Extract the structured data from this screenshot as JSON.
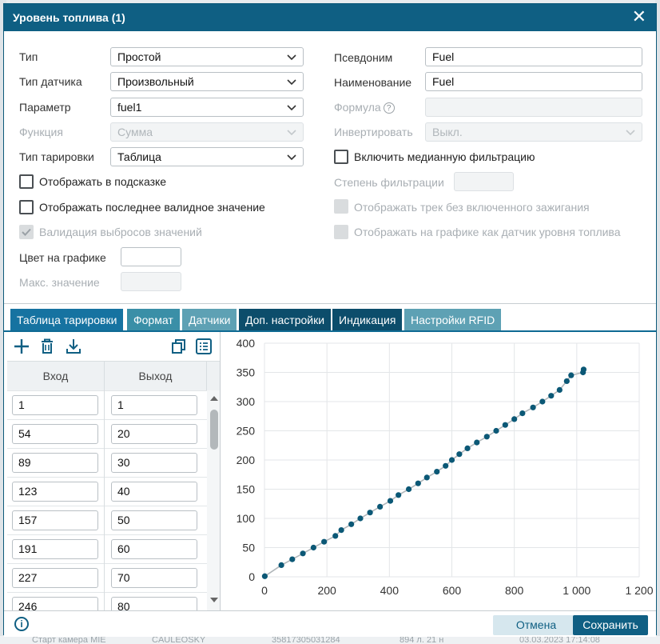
{
  "dialog": {
    "title": "Уровень топлива (1)"
  },
  "form": {
    "type_label": "Тип",
    "type_value": "Простой",
    "sensor_type_label": "Тип датчика",
    "sensor_type_value": "Произвольный",
    "param_label": "Параметр",
    "param_value": "fuel1",
    "function_label": "Функция",
    "function_value": "Сумма",
    "calib_type_label": "Тип тарировки",
    "calib_type_value": "Таблица",
    "alias_label": "Псевдоним",
    "alias_value": "Fuel",
    "name_label": "Наименование",
    "name_value": "Fuel",
    "formula_label": "Формула",
    "formula_value": "",
    "invert_label": "Инвертировать",
    "invert_value": "Выкл.",
    "median_label": "Включить медианную фильтрацию",
    "filter_degree_label": "Степень фильтрации",
    "track_label": "Отображать трек без включенного зажигания",
    "show_on_chart_label": "Отображать на графике как датчик уровня топлива",
    "tooltip_label": "Отображать в подсказке",
    "last_valid_label": "Отображать последнее валидное значение",
    "validation_label": "Валидация выбросов значений",
    "color_label": "Цвет на графике",
    "max_label": "Макс. значение"
  },
  "tabs": [
    "Таблица тарировки",
    "Формат",
    "Датчики",
    "Доп. настройки",
    "Индикация",
    "Настройки RFID"
  ],
  "table": {
    "col_in": "Вход",
    "col_out": "Выход",
    "rows": [
      {
        "in": "1",
        "out": "1"
      },
      {
        "in": "54",
        "out": "20"
      },
      {
        "in": "89",
        "out": "30"
      },
      {
        "in": "123",
        "out": "40"
      },
      {
        "in": "157",
        "out": "50"
      },
      {
        "in": "191",
        "out": "60"
      },
      {
        "in": "227",
        "out": "70"
      },
      {
        "in": "246",
        "out": "80"
      }
    ]
  },
  "chart_data": {
    "type": "line",
    "xlim": [
      0,
      1200
    ],
    "ylim": [
      0,
      400
    ],
    "xticks": [
      "0",
      "200",
      "400",
      "600",
      "800",
      "1 000",
      "1 200"
    ],
    "yticks": [
      "0",
      "50",
      "100",
      "150",
      "200",
      "250",
      "300",
      "350",
      "400"
    ],
    "grid": true,
    "line_color": "#b0b6ba",
    "point_color": "#0b5876",
    "x": [
      1,
      54,
      89,
      123,
      157,
      191,
      227,
      246,
      278,
      307,
      338,
      370,
      403,
      429,
      462,
      492,
      520,
      552,
      580,
      600,
      624,
      650,
      680,
      712,
      742,
      771,
      800,
      826,
      860,
      890,
      918,
      945,
      968,
      982,
      1020,
      1022
    ],
    "y": [
      1,
      20,
      30,
      40,
      50,
      60,
      70,
      80,
      90,
      100,
      110,
      120,
      130,
      140,
      150,
      160,
      170,
      180,
      190,
      200,
      210,
      220,
      230,
      240,
      250,
      260,
      270,
      280,
      290,
      300,
      310,
      320,
      335,
      345,
      350,
      355
    ]
  },
  "footer": {
    "cancel": "Отмена",
    "save": "Сохранить"
  },
  "colors": {
    "brand": "#0f5f83",
    "accent": "#1673a1"
  },
  "background": {
    "row_text_1": "Старт камера MIE",
    "row_text_2": "CAULEOSKY",
    "row_text_3": "35817305031284",
    "row_text_4": "894 л. 21 н",
    "row_text_5": "03.03.2023 17:14:08"
  }
}
